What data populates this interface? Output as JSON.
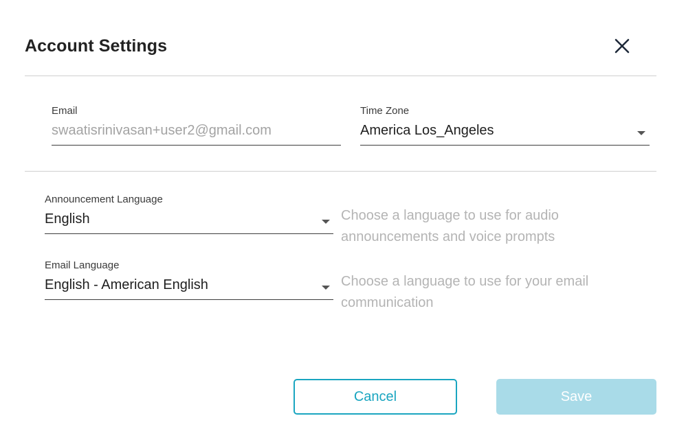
{
  "dialog": {
    "title": "Account Settings",
    "close_icon": "close-icon"
  },
  "account": {
    "email": {
      "label": "Email",
      "value": "swaatisrinivasan+user2@gmail.com"
    },
    "time_zone": {
      "label": "Time Zone",
      "value": "America Los_Angeles",
      "icon": "dropdown-arrow-icon"
    }
  },
  "language": {
    "announcement": {
      "label": "Announcement Language",
      "value": "English",
      "hint": "Choose a language to use for audio announcements and voice prompts",
      "icon": "dropdown-arrow-icon"
    },
    "email": {
      "label": "Email Language",
      "value": "English - American English",
      "hint": "Choose a language to use for your email communication",
      "icon": "dropdown-arrow-icon"
    }
  },
  "actions": {
    "cancel_label": "Cancel",
    "save_label": "Save"
  },
  "colors": {
    "accent": "#19a5c0",
    "save_disabled_bg": "#a9dbe8",
    "hint_text": "#b4b4b4",
    "divider": "#cfcfcf"
  }
}
